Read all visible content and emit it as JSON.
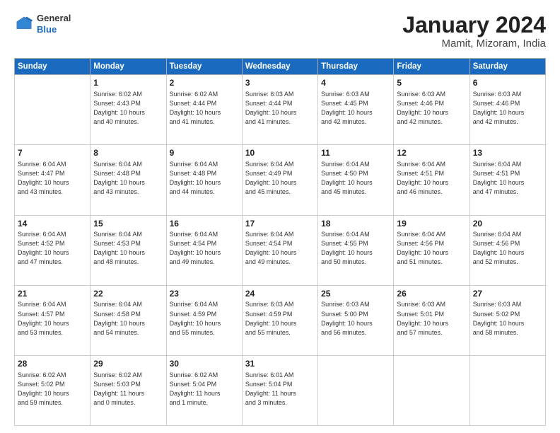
{
  "header": {
    "logo_general": "General",
    "logo_blue": "Blue",
    "title": "January 2024",
    "subtitle": "Mamit, Mizoram, India"
  },
  "weekdays": [
    "Sunday",
    "Monday",
    "Tuesday",
    "Wednesday",
    "Thursday",
    "Friday",
    "Saturday"
  ],
  "rows": [
    [
      {
        "day": "",
        "info": ""
      },
      {
        "day": "1",
        "info": "Sunrise: 6:02 AM\nSunset: 4:43 PM\nDaylight: 10 hours\nand 40 minutes."
      },
      {
        "day": "2",
        "info": "Sunrise: 6:02 AM\nSunset: 4:44 PM\nDaylight: 10 hours\nand 41 minutes."
      },
      {
        "day": "3",
        "info": "Sunrise: 6:03 AM\nSunset: 4:44 PM\nDaylight: 10 hours\nand 41 minutes."
      },
      {
        "day": "4",
        "info": "Sunrise: 6:03 AM\nSunset: 4:45 PM\nDaylight: 10 hours\nand 42 minutes."
      },
      {
        "day": "5",
        "info": "Sunrise: 6:03 AM\nSunset: 4:46 PM\nDaylight: 10 hours\nand 42 minutes."
      },
      {
        "day": "6",
        "info": "Sunrise: 6:03 AM\nSunset: 4:46 PM\nDaylight: 10 hours\nand 42 minutes."
      }
    ],
    [
      {
        "day": "7",
        "info": "Sunrise: 6:04 AM\nSunset: 4:47 PM\nDaylight: 10 hours\nand 43 minutes."
      },
      {
        "day": "8",
        "info": "Sunrise: 6:04 AM\nSunset: 4:48 PM\nDaylight: 10 hours\nand 43 minutes."
      },
      {
        "day": "9",
        "info": "Sunrise: 6:04 AM\nSunset: 4:48 PM\nDaylight: 10 hours\nand 44 minutes."
      },
      {
        "day": "10",
        "info": "Sunrise: 6:04 AM\nSunset: 4:49 PM\nDaylight: 10 hours\nand 45 minutes."
      },
      {
        "day": "11",
        "info": "Sunrise: 6:04 AM\nSunset: 4:50 PM\nDaylight: 10 hours\nand 45 minutes."
      },
      {
        "day": "12",
        "info": "Sunrise: 6:04 AM\nSunset: 4:51 PM\nDaylight: 10 hours\nand 46 minutes."
      },
      {
        "day": "13",
        "info": "Sunrise: 6:04 AM\nSunset: 4:51 PM\nDaylight: 10 hours\nand 47 minutes."
      }
    ],
    [
      {
        "day": "14",
        "info": "Sunrise: 6:04 AM\nSunset: 4:52 PM\nDaylight: 10 hours\nand 47 minutes."
      },
      {
        "day": "15",
        "info": "Sunrise: 6:04 AM\nSunset: 4:53 PM\nDaylight: 10 hours\nand 48 minutes."
      },
      {
        "day": "16",
        "info": "Sunrise: 6:04 AM\nSunset: 4:54 PM\nDaylight: 10 hours\nand 49 minutes."
      },
      {
        "day": "17",
        "info": "Sunrise: 6:04 AM\nSunset: 4:54 PM\nDaylight: 10 hours\nand 49 minutes."
      },
      {
        "day": "18",
        "info": "Sunrise: 6:04 AM\nSunset: 4:55 PM\nDaylight: 10 hours\nand 50 minutes."
      },
      {
        "day": "19",
        "info": "Sunrise: 6:04 AM\nSunset: 4:56 PM\nDaylight: 10 hours\nand 51 minutes."
      },
      {
        "day": "20",
        "info": "Sunrise: 6:04 AM\nSunset: 4:56 PM\nDaylight: 10 hours\nand 52 minutes."
      }
    ],
    [
      {
        "day": "21",
        "info": "Sunrise: 6:04 AM\nSunset: 4:57 PM\nDaylight: 10 hours\nand 53 minutes."
      },
      {
        "day": "22",
        "info": "Sunrise: 6:04 AM\nSunset: 4:58 PM\nDaylight: 10 hours\nand 54 minutes."
      },
      {
        "day": "23",
        "info": "Sunrise: 6:04 AM\nSunset: 4:59 PM\nDaylight: 10 hours\nand 55 minutes."
      },
      {
        "day": "24",
        "info": "Sunrise: 6:03 AM\nSunset: 4:59 PM\nDaylight: 10 hours\nand 55 minutes."
      },
      {
        "day": "25",
        "info": "Sunrise: 6:03 AM\nSunset: 5:00 PM\nDaylight: 10 hours\nand 56 minutes."
      },
      {
        "day": "26",
        "info": "Sunrise: 6:03 AM\nSunset: 5:01 PM\nDaylight: 10 hours\nand 57 minutes."
      },
      {
        "day": "27",
        "info": "Sunrise: 6:03 AM\nSunset: 5:02 PM\nDaylight: 10 hours\nand 58 minutes."
      }
    ],
    [
      {
        "day": "28",
        "info": "Sunrise: 6:02 AM\nSunset: 5:02 PM\nDaylight: 10 hours\nand 59 minutes."
      },
      {
        "day": "29",
        "info": "Sunrise: 6:02 AM\nSunset: 5:03 PM\nDaylight: 11 hours\nand 0 minutes."
      },
      {
        "day": "30",
        "info": "Sunrise: 6:02 AM\nSunset: 5:04 PM\nDaylight: 11 hours\nand 1 minute."
      },
      {
        "day": "31",
        "info": "Sunrise: 6:01 AM\nSunset: 5:04 PM\nDaylight: 11 hours\nand 3 minutes."
      },
      {
        "day": "",
        "info": ""
      },
      {
        "day": "",
        "info": ""
      },
      {
        "day": "",
        "info": ""
      }
    ]
  ]
}
